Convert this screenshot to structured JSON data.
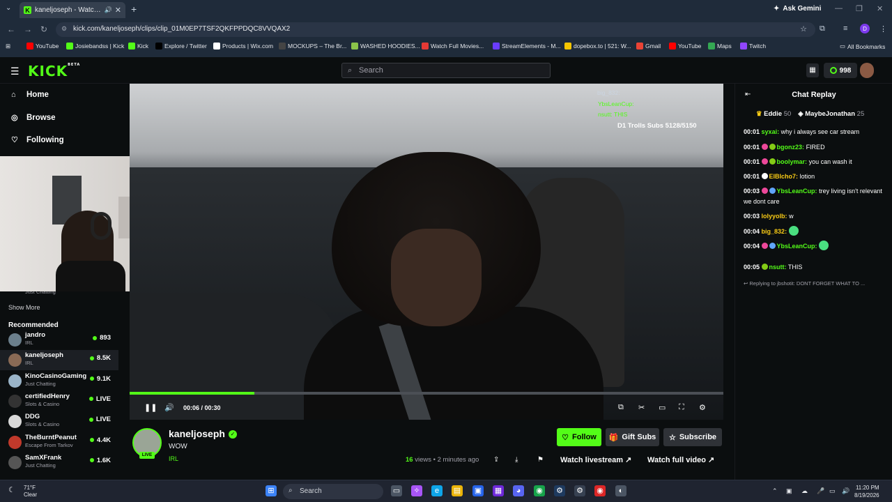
{
  "browser": {
    "tab_title": "kaneljoseph - Watch clips c",
    "url": "kick.com/kaneljoseph/clips/clip_01M0EP7TSF2QKFPPDQC8VVQAX2",
    "ask_gemini": "Ask Gemini",
    "avatar_letter": "D",
    "bookmarks": [
      {
        "label": "YouTube",
        "color": "#ff0000"
      },
      {
        "label": "Josiebandss | Kick",
        "color": "#53fc18"
      },
      {
        "label": "Kick",
        "color": "#53fc18"
      },
      {
        "label": "Explore / Twitter",
        "color": "#000000"
      },
      {
        "label": "Products | Wix.com",
        "color": "#ffffff"
      },
      {
        "label": "MOCKUPS – The Br...",
        "color": "#444444"
      },
      {
        "label": "WASHED HOODIES...",
        "color": "#8bc34a"
      },
      {
        "label": "Watch Full Movies...",
        "color": "#e53935"
      },
      {
        "label": "StreamElements - M...",
        "color": "#6a3cff"
      },
      {
        "label": "dopebox.to | 521: W...",
        "color": "#f7c600"
      },
      {
        "label": "Gmail",
        "color": "#ea4335"
      },
      {
        "label": "YouTube",
        "color": "#ff0000"
      },
      {
        "label": "Maps",
        "color": "#34a853"
      },
      {
        "label": "Twitch",
        "color": "#9146ff"
      }
    ],
    "all_bookmarks": "All Bookmarks"
  },
  "kick": {
    "logo": "KICK",
    "logo_sup": "BETA",
    "search_placeholder": "Search",
    "points": "998",
    "nav": [
      {
        "label": "Home",
        "icon": "home-icon"
      },
      {
        "label": "Browse",
        "icon": "compass-icon"
      },
      {
        "label": "Following",
        "icon": "heart-icon"
      }
    ],
    "webcam_caption": "Just Chatting",
    "show_more": "Show More",
    "recommended_title": "Recommended",
    "recommended": [
      {
        "name": "jandro",
        "category": "IRL",
        "viewers": "893",
        "color": "#6b7f8c"
      },
      {
        "name": "kaneljoseph",
        "category": "IRL",
        "viewers": "8.5K",
        "color": "#8a6a55"
      },
      {
        "name": "KinoCasinoGaming",
        "category": "Just Chatting",
        "viewers": "9.1K",
        "color": "#9ab4c8"
      },
      {
        "name": "certifiedHenry",
        "category": "Slots & Casino",
        "viewers": "LIVE",
        "color": "#333333"
      },
      {
        "name": "DDG",
        "category": "Slots & Casino",
        "viewers": "LIVE",
        "color": "#d9d9d9"
      },
      {
        "name": "TheBurntPeanut",
        "category": "Escape From Tarkov",
        "viewers": "4.4K",
        "color": "#c0392b"
      },
      {
        "name": "SamXFrank",
        "category": "Just Chatting",
        "viewers": "1.6K",
        "color": "#555555"
      }
    ]
  },
  "player": {
    "overlay_chat": [
      {
        "text": "big_832:"
      },
      {
        "text": "YbsLeanCup:"
      },
      {
        "text": "nsutt: THIS"
      }
    ],
    "sub_goal": "D1 Trolls Subs 5128/5150",
    "current_time": "00:06",
    "duration": "00:30",
    "progress": 0.21
  },
  "clip": {
    "channel": "kaneljoseph",
    "title": "WOW",
    "category": "IRL",
    "live_badge": "LIVE",
    "views": "16",
    "views_label": "views",
    "age": "2 minutes ago",
    "follow": "Follow",
    "gift_subs": "Gift Subs",
    "subscribe": "Subscribe",
    "watch_livestream": "Watch livestream",
    "watch_full_video": "Watch full video"
  },
  "chat": {
    "title": "Chat Replay",
    "leaders": [
      {
        "name": "Eddie",
        "count": "50"
      },
      {
        "name": "MaybeJonathan",
        "count": "25"
      }
    ],
    "messages": [
      {
        "time": "00:01",
        "user": "syxai:",
        "text": "why i always see car stream",
        "color": "#53fc18",
        "badges": []
      },
      {
        "time": "00:01",
        "user": "bgonz23:",
        "text": "FIRED",
        "color": "#53fc18",
        "badges": [
          "#ec4899",
          "#84cc16"
        ]
      },
      {
        "time": "00:01",
        "user": "boolymar:",
        "text": "you can wash it",
        "color": "#53fc18",
        "badges": [
          "#ec4899",
          "#84cc16"
        ]
      },
      {
        "time": "00:01",
        "user": "ElBlcho7:",
        "text": "lotion",
        "color": "#facc15",
        "badges": [
          "#ffffff"
        ]
      },
      {
        "time": "00:03",
        "user": "YbsLeanCup:",
        "text": "trey living isn't relevant we dont care",
        "color": "#53fc18",
        "badges": [
          "#ec4899",
          "#60a5fa"
        ]
      },
      {
        "time": "00:03",
        "user": "lolyyolb:",
        "text": "w",
        "color": "#facc15",
        "badges": []
      },
      {
        "time": "00:04",
        "user": "big_832:",
        "text": "",
        "color": "#facc15",
        "badges": []
      },
      {
        "time": "00:04",
        "user": "YbsLeanCup:",
        "text": "",
        "color": "#53fc18",
        "badges": [
          "#ec4899",
          "#60a5fa"
        ]
      },
      {
        "time": "00:05",
        "user": "nsutt:",
        "text": "THIS",
        "color": "#53fc18",
        "badges": [
          "#84cc16"
        ]
      }
    ],
    "reply_note": "Replying to jbshotit: DONT FORGET WHAT TO ..."
  },
  "taskbar": {
    "temp": "71°F",
    "cond": "Clear",
    "search": "Search",
    "time": "11:20 PM",
    "date": "8/19/2026"
  }
}
